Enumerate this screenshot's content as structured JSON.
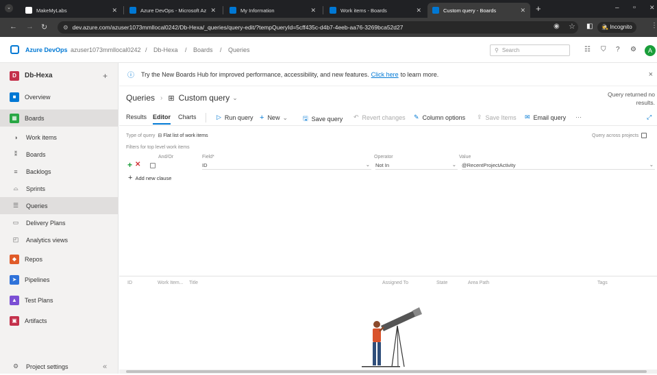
{
  "browser": {
    "tabs": [
      {
        "title": "MakeMyLabs",
        "active": false,
        "icon_color": "#ffffff"
      },
      {
        "title": "Azure DevOps - Microsoft Azu",
        "active": false,
        "icon_color": "#0078d4"
      },
      {
        "title": "My Information",
        "active": false,
        "icon_color": "#0078d4"
      },
      {
        "title": "Work items - Boards",
        "active": false,
        "icon_color": "#0078d4"
      },
      {
        "title": "Custom query - Boards",
        "active": true,
        "icon_color": "#0078d4"
      }
    ],
    "new_tab_label": "+",
    "window_controls": {
      "min": "–",
      "max": "▫",
      "close": "✕"
    },
    "url": "dev.azure.com/azuser1073mmllocal0242/Db-Hexa/_queries/query-edit/?tempQueryId=5cff435c-d4b7-4eeb-aa76-3269bca52d27",
    "incognito_label": "Incognito"
  },
  "header": {
    "brand": "Azure DevOps",
    "org": "azuser1073mmllocal0242",
    "project": "Db-Hexa",
    "section": "Boards",
    "page": "Queries",
    "search_placeholder": "Search",
    "avatar_letter": "A"
  },
  "sidebar": {
    "project": {
      "letter": "D",
      "name": "Db-Hexa",
      "add": "+"
    },
    "items": [
      {
        "label": "Overview",
        "icon": "overview-icon",
        "color": "#0078d4"
      },
      {
        "label": "Boards",
        "icon": "boards-icon",
        "color": "#29a744"
      },
      {
        "label": "Work items",
        "icon": "work-items-icon"
      },
      {
        "label": "Boards",
        "icon": "kanban-icon"
      },
      {
        "label": "Backlogs",
        "icon": "backlogs-icon"
      },
      {
        "label": "Sprints",
        "icon": "sprints-icon"
      },
      {
        "label": "Queries",
        "icon": "queries-icon"
      },
      {
        "label": "Delivery Plans",
        "icon": "delivery-plans-icon"
      },
      {
        "label": "Analytics views",
        "icon": "analytics-icon"
      },
      {
        "label": "Repos",
        "icon": "repos-icon",
        "color": "#e05b29"
      },
      {
        "label": "Pipelines",
        "icon": "pipelines-icon",
        "color": "#2f72d9"
      },
      {
        "label": "Test Plans",
        "icon": "test-plans-icon",
        "color": "#7b4fd4"
      },
      {
        "label": "Artifacts",
        "icon": "artifacts-icon",
        "color": "#c4314b"
      }
    ],
    "settings": "Project settings",
    "collapse": "«"
  },
  "banner": {
    "text": "Try the New Boards Hub for improved performance, accessibility, and new features.",
    "link": "Click here",
    "suffix": "to learn more.",
    "close": "×"
  },
  "query": {
    "breadcrumb_root": "Queries",
    "name": "Custom query",
    "status": "Query returned no results.",
    "tabs": [
      "Results",
      "Editor",
      "Charts"
    ],
    "actions": {
      "run": "Run query",
      "new": "New",
      "save": "Save query",
      "revert": "Revert changes",
      "columns": "Column options",
      "save_items": "Save Items",
      "email": "Email query",
      "more": "···"
    },
    "type_label": "Type of query",
    "type_value": "Flat list of work items",
    "across_projects": "Query across projects",
    "filters_label": "Filters for top level work items",
    "col_andor": "And/Or",
    "col_field": "Field*",
    "col_operator": "Operator",
    "col_value": "Value",
    "clause": {
      "field": "ID",
      "operator": "Not In",
      "value": "@RecentProjectActivity"
    },
    "add_clause": "Add new clause"
  },
  "grid": {
    "columns": [
      "ID",
      "Work Item...",
      "Title",
      "Assigned To",
      "State",
      "Area Path",
      "Tags"
    ]
  }
}
